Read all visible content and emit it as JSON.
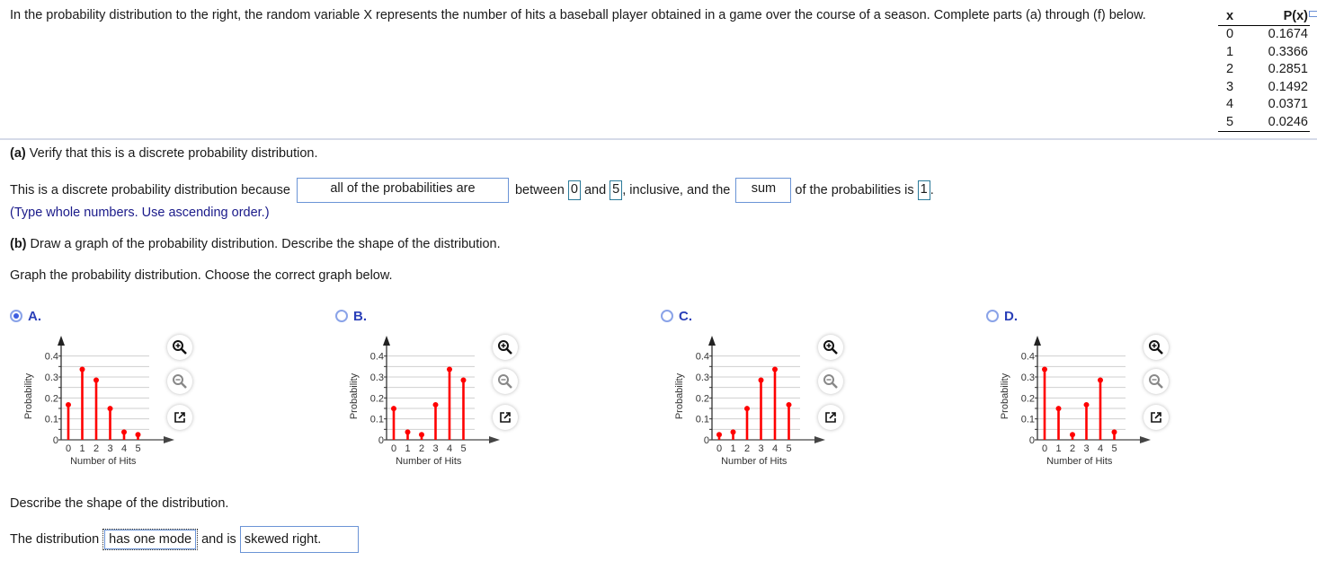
{
  "question": {
    "intro": "In the probability distribution to the right, the random variable X represents the number of hits a baseball player obtained in a game over the course of a season. Complete parts (a) through (f) below."
  },
  "table": {
    "headers": [
      "x",
      "P(x)"
    ],
    "rows": [
      {
        "x": "0",
        "p": "0.1674"
      },
      {
        "x": "1",
        "p": "0.3366"
      },
      {
        "x": "2",
        "p": "0.2851"
      },
      {
        "x": "3",
        "p": "0.1492"
      },
      {
        "x": "4",
        "p": "0.0371"
      },
      {
        "x": "5",
        "p": "0.0246"
      }
    ],
    "expand_icon": "expand-icon"
  },
  "part_a": {
    "label": "(a)",
    "title": "Verify that this is a discrete probability distribution.",
    "sentence_start": "This is a discrete probability distribution because",
    "dropdown1_value": "all of the probabilities are",
    "between": "between",
    "low_value": "0",
    "and": "and",
    "high_value": "5",
    "inclusive": ", inclusive, and the",
    "dropdown2_value": "sum",
    "of_probs": "of the probabilities is",
    "sum_value": "1",
    "period": ".",
    "hint": "(Type whole numbers. Use ascending order.)"
  },
  "part_b": {
    "label": "(b)",
    "title": "Draw a graph of the probability distribution. Describe the shape of the distribution.",
    "instruction": "Graph the probability distribution. Choose the correct graph below.",
    "selected": "A",
    "options": [
      {
        "letter": "A.",
        "selected": true
      },
      {
        "letter": "B.",
        "selected": false
      },
      {
        "letter": "C.",
        "selected": false
      },
      {
        "letter": "D.",
        "selected": false
      }
    ],
    "tools": [
      "zoom-in-icon",
      "zoom-out-icon",
      "open-new-window-icon"
    ],
    "describe_prompt": "Describe the shape of the distribution.",
    "describe_start": "The distribution",
    "mode_value": "has one mode",
    "and_is": "and is",
    "skew_value": "skewed right."
  },
  "chart_data": [
    {
      "type": "bar",
      "option": "A",
      "categories": [
        "0",
        "1",
        "2",
        "3",
        "4",
        "5"
      ],
      "values": [
        0.1674,
        0.3366,
        0.2851,
        0.1492,
        0.0371,
        0.0246
      ],
      "xlabel": "Number of Hits",
      "ylabel": "Probability",
      "yticks": [
        "0",
        "0.1",
        "0.2",
        "0.3",
        "0.4"
      ],
      "ylim": [
        0,
        0.45
      ],
      "grid": true
    },
    {
      "type": "bar",
      "option": "B",
      "categories": [
        "0",
        "1",
        "2",
        "3",
        "4",
        "5"
      ],
      "values": [
        0.1492,
        0.0371,
        0.0246,
        0.1674,
        0.3366,
        0.2851
      ],
      "xlabel": "Number of Hits",
      "ylabel": "Probability",
      "yticks": [
        "0",
        "0.1",
        "0.2",
        "0.3",
        "0.4"
      ],
      "ylim": [
        0,
        0.45
      ],
      "grid": true
    },
    {
      "type": "bar",
      "option": "C",
      "categories": [
        "0",
        "1",
        "2",
        "3",
        "4",
        "5"
      ],
      "values": [
        0.0246,
        0.0371,
        0.1492,
        0.2851,
        0.3366,
        0.1674
      ],
      "xlabel": "Number of Hits",
      "ylabel": "Probability",
      "yticks": [
        "0",
        "0.1",
        "0.2",
        "0.3",
        "0.4"
      ],
      "ylim": [
        0,
        0.45
      ],
      "grid": true
    },
    {
      "type": "bar",
      "option": "D",
      "categories": [
        "0",
        "1",
        "2",
        "3",
        "4",
        "5"
      ],
      "values": [
        0.3366,
        0.1492,
        0.0246,
        0.1674,
        0.2851,
        0.0371
      ],
      "xlabel": "Number of Hits",
      "ylabel": "Probability",
      "yticks": [
        "0",
        "0.1",
        "0.2",
        "0.3",
        "0.4"
      ],
      "ylim": [
        0,
        0.45
      ],
      "grid": true
    }
  ],
  "colors": {
    "stem": "#ff0000",
    "option_label": "#2a3fb8",
    "answer_border": "#6b94d6",
    "hint": "#1a1a8a"
  }
}
